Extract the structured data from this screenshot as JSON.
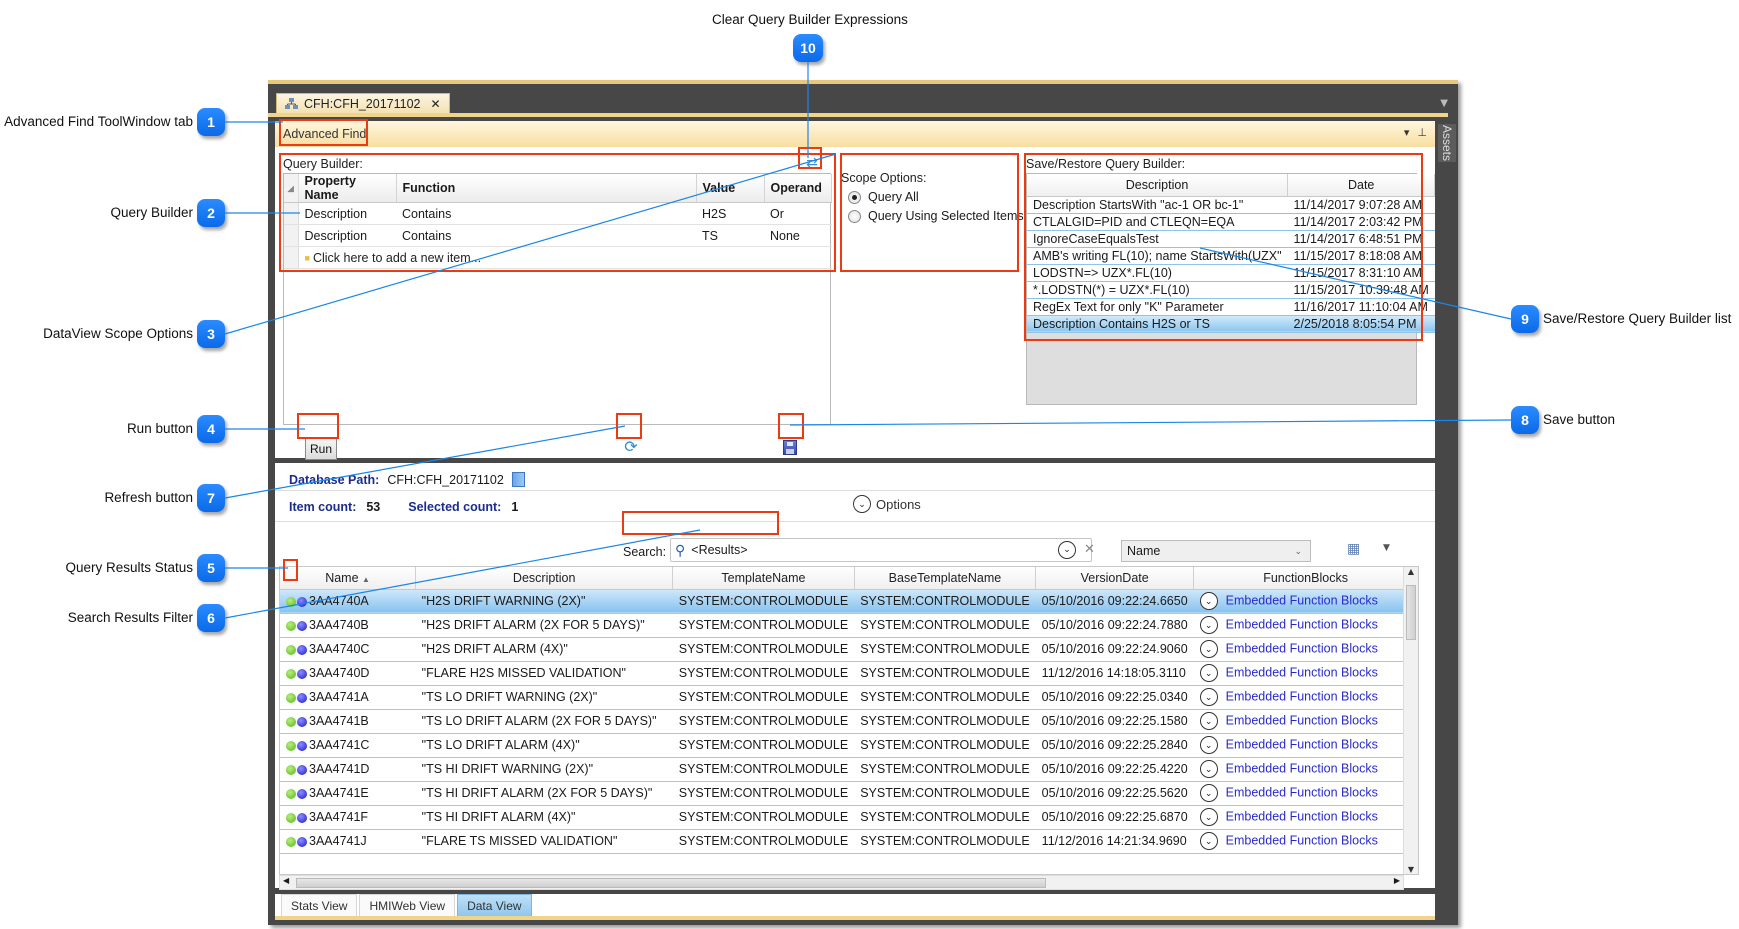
{
  "callouts": {
    "c1": {
      "number": "1",
      "label": "Advanced Find ToolWindow tab"
    },
    "c2": {
      "number": "2",
      "label": "Query Builder"
    },
    "c3": {
      "number": "3",
      "label": "DataView Scope Options"
    },
    "c4": {
      "number": "4",
      "label": "Run button"
    },
    "c5": {
      "number": "5",
      "label": "Query Results Status"
    },
    "c6": {
      "number": "6",
      "label": "Search Results Filter"
    },
    "c7": {
      "number": "7",
      "label": "Refresh button"
    },
    "c8": {
      "number": "8",
      "label": "Save button"
    },
    "c9": {
      "number": "9",
      "label": "Save/Restore Query Builder list"
    },
    "c10": {
      "number": "10",
      "label": "Clear Query Builder Expressions"
    }
  },
  "window": {
    "doc_tab_title": "CFH:CFH_20171102",
    "doc_tab_close": "✕",
    "tool_window_title": "Advanced Find",
    "side_tab": "Assets"
  },
  "query_builder": {
    "label": "Query Builder:",
    "columns": [
      "Property Name",
      "Function",
      "Value",
      "Operand"
    ],
    "rows": [
      {
        "property": "Description",
        "function": "Contains",
        "value": "H2S",
        "operand": "Or"
      },
      {
        "property": "Description",
        "function": "Contains",
        "value": "TS",
        "operand": "None"
      }
    ],
    "add_item_text": "Click here to add a new item..."
  },
  "scope": {
    "label": "Scope Options:",
    "options": [
      {
        "label": "Query All",
        "selected": true
      },
      {
        "label": "Query Using Selected Items",
        "selected": false
      }
    ]
  },
  "save_restore": {
    "label": "Save/Restore Query Builder:",
    "columns": [
      "Description",
      "Date"
    ],
    "rows": [
      {
        "description": "Description StartsWith \"ac-1 OR bc-1\"",
        "date": "11/14/2017 9:07:28 AM"
      },
      {
        "description": "CTLALGID=PID and CTLEQN=EQA",
        "date": "11/14/2017 2:03:42 PM"
      },
      {
        "description": "IgnoreCaseEqualsTest",
        "date": "11/14/2017 6:48:51 PM"
      },
      {
        "description": "AMB's writing FL(10); name StartsWith(UZX\"",
        "date": "11/15/2017 8:18:08 AM"
      },
      {
        "description": "LODSTN=> UZX*.FL(10)",
        "date": "11/15/2017 8:31:10 AM"
      },
      {
        "description": "*.LODSTN(*) = UZX*.FL(10)",
        "date": "11/15/2017 10:39:48 AM"
      },
      {
        "description": "RegEx Text for only \"K\" Parameter",
        "date": "11/16/2017 11:10:04 AM"
      },
      {
        "description": "Description Contains H2S or TS",
        "date": "2/25/2018 8:05:54 PM",
        "selected": true
      }
    ]
  },
  "actions": {
    "run_label": "Run"
  },
  "results": {
    "database_path_label": "Database Path:",
    "database_path_value": "CFH:CFH_20171102",
    "item_count_label": "Item count:",
    "item_count": "53",
    "selected_count_label": "Selected count:",
    "selected_count": "1",
    "options_label": "Options",
    "search_label": "Search:",
    "search_value": "<Results>",
    "search_field_selected": "Name",
    "columns": [
      "Name",
      "Description",
      "TemplateName",
      "BaseTemplateName",
      "VersionDate",
      "FunctionBlocks"
    ],
    "sort_indicator": "▲",
    "rows": [
      {
        "name": "3AA4740A",
        "description": "\"H2S DRIFT WARNING (2X)\"",
        "template": "SYSTEM:CONTROLMODULE",
        "base_template": "SYSTEM:CONTROLMODULE",
        "version_date": "05/10/2016 09:22:24.6650",
        "function_blocks": "Embedded Function Blocks",
        "selected": true
      },
      {
        "name": "3AA4740B",
        "description": "\"H2S DRIFT ALARM (2X FOR 5 DAYS)\"",
        "template": "SYSTEM:CONTROLMODULE",
        "base_template": "SYSTEM:CONTROLMODULE",
        "version_date": "05/10/2016 09:22:24.7880",
        "function_blocks": "Embedded Function Blocks"
      },
      {
        "name": "3AA4740C",
        "description": "\"H2S DRIFT ALARM (4X)\"",
        "template": "SYSTEM:CONTROLMODULE",
        "base_template": "SYSTEM:CONTROLMODULE",
        "version_date": "05/10/2016 09:22:24.9060",
        "function_blocks": "Embedded Function Blocks"
      },
      {
        "name": "3AA4740D",
        "description": "\"FLARE H2S MISSED VALIDATION\"",
        "template": "SYSTEM:CONTROLMODULE",
        "base_template": "SYSTEM:CONTROLMODULE",
        "version_date": "11/12/2016 14:18:05.3110",
        "function_blocks": "Embedded Function Blocks"
      },
      {
        "name": "3AA4741A",
        "description": "\"TS LO DRIFT WARNING (2X)\"",
        "template": "SYSTEM:CONTROLMODULE",
        "base_template": "SYSTEM:CONTROLMODULE",
        "version_date": "05/10/2016 09:22:25.0340",
        "function_blocks": "Embedded Function Blocks"
      },
      {
        "name": "3AA4741B",
        "description": "\"TS LO DRIFT ALARM (2X FOR 5 DAYS)\"",
        "template": "SYSTEM:CONTROLMODULE",
        "base_template": "SYSTEM:CONTROLMODULE",
        "version_date": "05/10/2016 09:22:25.1580",
        "function_blocks": "Embedded Function Blocks"
      },
      {
        "name": "3AA4741C",
        "description": "\"TS LO DRIFT ALARM (4X)\"",
        "template": "SYSTEM:CONTROLMODULE",
        "base_template": "SYSTEM:CONTROLMODULE",
        "version_date": "05/10/2016 09:22:25.2840",
        "function_blocks": "Embedded Function Blocks"
      },
      {
        "name": "3AA4741D",
        "description": "\"TS HI DRIFT WARNING (2X)\"",
        "template": "SYSTEM:CONTROLMODULE",
        "base_template": "SYSTEM:CONTROLMODULE",
        "version_date": "05/10/2016 09:22:25.4220",
        "function_blocks": "Embedded Function Blocks"
      },
      {
        "name": "3AA4741E",
        "description": "\"TS HI DRIFT ALARM (2X FOR 5 DAYS)\"",
        "template": "SYSTEM:CONTROLMODULE",
        "base_template": "SYSTEM:CONTROLMODULE",
        "version_date": "05/10/2016 09:22:25.5620",
        "function_blocks": "Embedded Function Blocks"
      },
      {
        "name": "3AA4741F",
        "description": "\"TS HI DRIFT ALARM (4X)\"",
        "template": "SYSTEM:CONTROLMODULE",
        "base_template": "SYSTEM:CONTROLMODULE",
        "version_date": "05/10/2016 09:22:25.6870",
        "function_blocks": "Embedded Function Blocks"
      },
      {
        "name": "3AA4741J",
        "description": "\"FLARE TS MISSED VALIDATION\"",
        "template": "SYSTEM:CONTROLMODULE",
        "base_template": "SYSTEM:CONTROLMODULE",
        "version_date": "11/12/2016 14:21:34.9690",
        "function_blocks": "Embedded Function Blocks"
      }
    ]
  },
  "bottom_tabs": [
    {
      "label": "Stats View",
      "active": false
    },
    {
      "label": "HMIWeb View",
      "active": false
    },
    {
      "label": "Data View",
      "active": true
    }
  ],
  "colors": {
    "accent_callout": "#0a6ae8",
    "highlight_box": "#ec3b12",
    "selection": "#87c2ee",
    "link": "#2a2acc",
    "status_green": "#56b51c",
    "status_blue": "#1616c8"
  }
}
